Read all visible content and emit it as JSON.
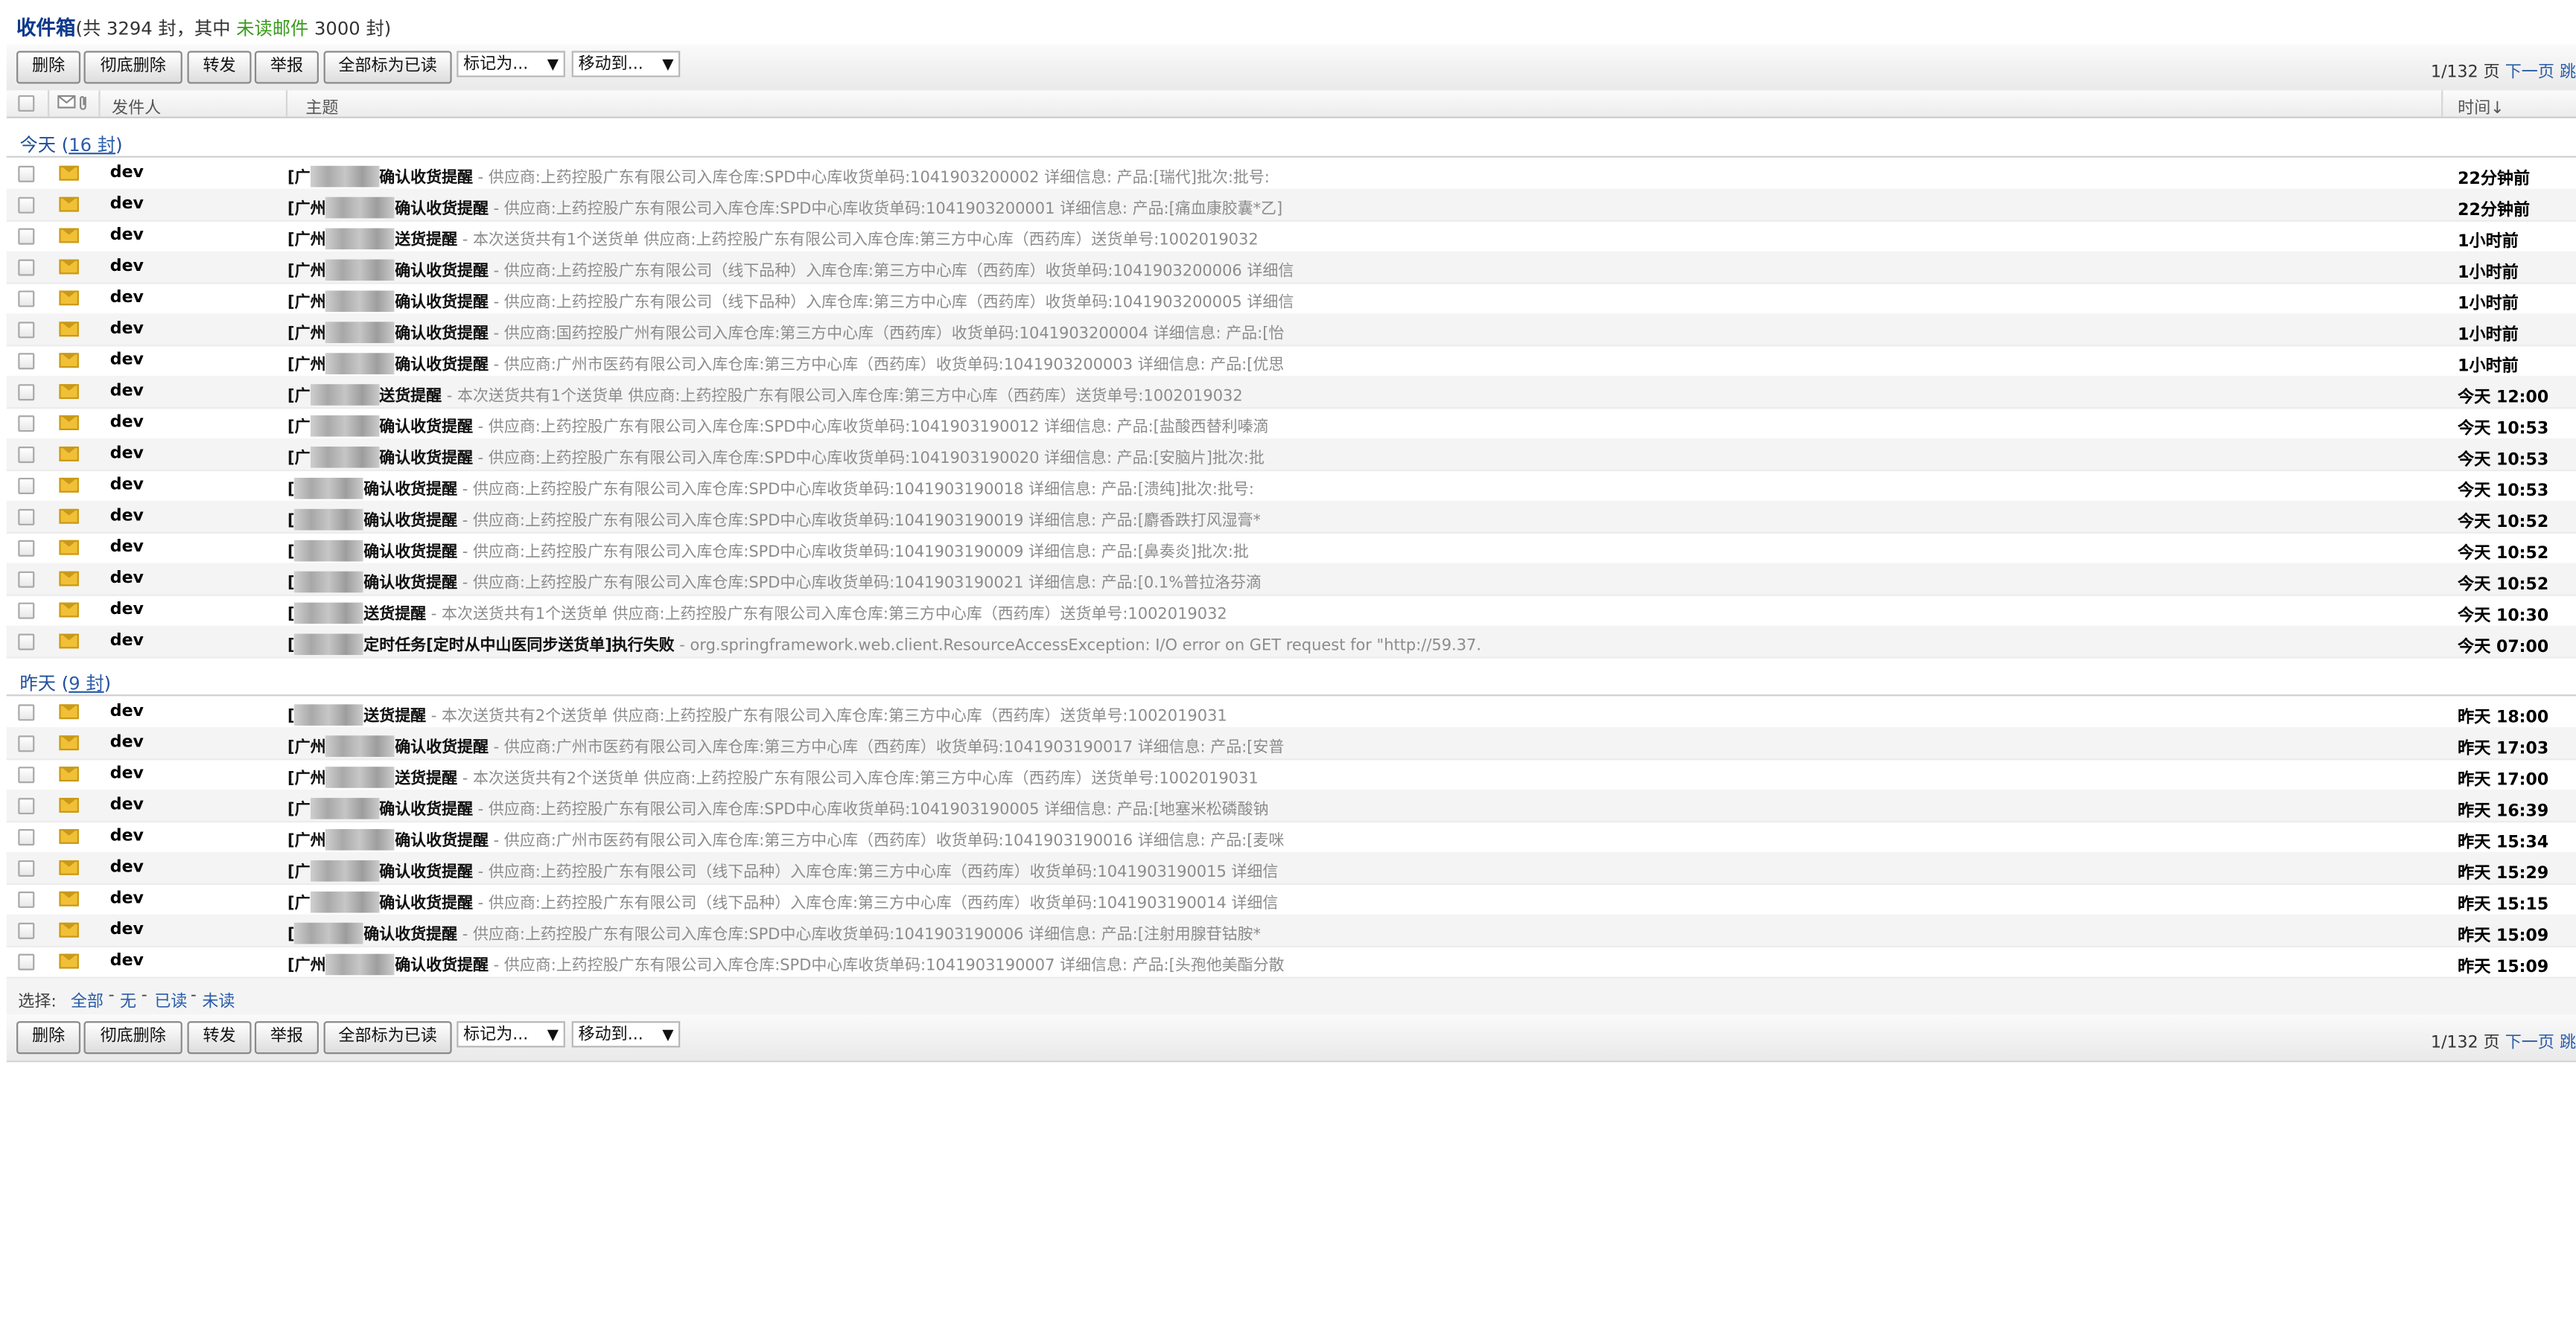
{
  "header": {
    "title": "收件箱",
    "summary_prefix": "(共 3294 封，其中 ",
    "unread_label": "未读邮件",
    "summary_suffix": " 3000 封)"
  },
  "toolbar": {
    "delete": "删除",
    "delete_perm": "彻底删除",
    "forward": "转发",
    "report": "举报",
    "mark_all_read": "全部标为已读",
    "mark_as": "标记为...",
    "move_to": "移动到...",
    "page": "1/132 页",
    "next": "下一页",
    "jump": "跳"
  },
  "columns": {
    "sender": "发件人",
    "subject": "主题",
    "time": "时间↓"
  },
  "groups": [
    {
      "label": "今天",
      "count": "16 封"
    },
    {
      "label": "昨天",
      "count": "9 封"
    }
  ],
  "emails_today": [
    {
      "sender": "dev",
      "prefix": "[广",
      "subject": "确认收货提醒",
      "preview": " - 供应商:上药控股广东有限公司入库仓库:SPD中心库收货单码:1041903200002 详细信息: 产品:[瑞代]批次:批号:",
      "time": "22分钟前"
    },
    {
      "sender": "dev",
      "prefix": "[广州",
      "subject": "确认收货提醒",
      "preview": " - 供应商:上药控股广东有限公司入库仓库:SPD中心库收货单码:1041903200001 详细信息: 产品:[痛血康胶囊*乙]",
      "time": "22分钟前"
    },
    {
      "sender": "dev",
      "prefix": "[广州",
      "subject": "送货提醒",
      "preview": " - 本次送货共有1个送货单 供应商:上药控股广东有限公司入库仓库:第三方中心库（西药库）送货单号:1002019032",
      "time": "1小时前"
    },
    {
      "sender": "dev",
      "prefix": "[广州",
      "subject": "确认收货提醒",
      "preview": " - 供应商:上药控股广东有限公司（线下品种）入库仓库:第三方中心库（西药库）收货单码:1041903200006 详细信",
      "time": "1小时前"
    },
    {
      "sender": "dev",
      "prefix": "[广州",
      "subject": "确认收货提醒",
      "preview": " - 供应商:上药控股广东有限公司（线下品种）入库仓库:第三方中心库（西药库）收货单码:1041903200005 详细信",
      "time": "1小时前"
    },
    {
      "sender": "dev",
      "prefix": "[广州",
      "subject": "确认收货提醒",
      "preview": " - 供应商:国药控股广州有限公司入库仓库:第三方中心库（西药库）收货单码:1041903200004 详细信息: 产品:[怡",
      "time": "1小时前"
    },
    {
      "sender": "dev",
      "prefix": "[广州",
      "subject": "确认收货提醒",
      "preview": " - 供应商:广州市医药有限公司入库仓库:第三方中心库（西药库）收货单码:1041903200003 详细信息: 产品:[优思",
      "time": "1小时前"
    },
    {
      "sender": "dev",
      "prefix": "[广",
      "subject": "送货提醒",
      "preview": " - 本次送货共有1个送货单 供应商:上药控股广东有限公司入库仓库:第三方中心库（西药库）送货单号:1002019032",
      "time": "今天 12:00"
    },
    {
      "sender": "dev",
      "prefix": "[广",
      "subject": "确认收货提醒",
      "preview": " - 供应商:上药控股广东有限公司入库仓库:SPD中心库收货单码:1041903190012 详细信息: 产品:[盐酸西替利嗪滴",
      "time": "今天 10:53"
    },
    {
      "sender": "dev",
      "prefix": "[广",
      "subject": "确认收货提醒",
      "preview": " - 供应商:上药控股广东有限公司入库仓库:SPD中心库收货单码:1041903190020 详细信息: 产品:[安脑片]批次:批",
      "time": "今天 10:53"
    },
    {
      "sender": "dev",
      "prefix": "[",
      "subject": "确认收货提醒",
      "preview": " - 供应商:上药控股广东有限公司入库仓库:SPD中心库收货单码:1041903190018 详细信息: 产品:[溃纯]批次:批号:",
      "time": "今天 10:53"
    },
    {
      "sender": "dev",
      "prefix": "[",
      "subject": "确认收货提醒",
      "preview": " - 供应商:上药控股广东有限公司入库仓库:SPD中心库收货单码:1041903190019 详细信息: 产品:[麝香跌打风湿膏*",
      "time": "今天 10:52"
    },
    {
      "sender": "dev",
      "prefix": "[",
      "subject": "确认收货提醒",
      "preview": " - 供应商:上药控股广东有限公司入库仓库:SPD中心库收货单码:1041903190009 详细信息: 产品:[鼻奏炎]批次:批",
      "time": "今天 10:52"
    },
    {
      "sender": "dev",
      "prefix": "[",
      "subject": "确认收货提醒",
      "preview": " - 供应商:上药控股广东有限公司入库仓库:SPD中心库收货单码:1041903190021 详细信息: 产品:[0.1%普拉洛芬滴",
      "time": "今天 10:52"
    },
    {
      "sender": "dev",
      "prefix": "[",
      "subject": "送货提醒",
      "preview": " - 本次送货共有1个送货单 供应商:上药控股广东有限公司入库仓库:第三方中心库（西药库）送货单号:1002019032",
      "time": "今天 10:30"
    },
    {
      "sender": "dev",
      "prefix": "[",
      "subject": "定时任务[定时从中山医同步送货单]执行失败",
      "preview": " - org.springframework.web.client.ResourceAccessException: I/O error on GET request for \"http://59.37.",
      "time": "今天 07:00"
    }
  ],
  "emails_yesterday": [
    {
      "sender": "dev",
      "prefix": "[",
      "subject": "送货提醒",
      "preview": " - 本次送货共有2个送货单 供应商:上药控股广东有限公司入库仓库:第三方中心库（西药库）送货单号:1002019031",
      "time": "昨天 18:00"
    },
    {
      "sender": "dev",
      "prefix": "[广州",
      "subject": "确认收货提醒",
      "preview": " - 供应商:广州市医药有限公司入库仓库:第三方中心库（西药库）收货单码:1041903190017 详细信息: 产品:[安普",
      "time": "昨天 17:03"
    },
    {
      "sender": "dev",
      "prefix": "[广州",
      "subject": "送货提醒",
      "preview": " - 本次送货共有2个送货单 供应商:上药控股广东有限公司入库仓库:第三方中心库（西药库）送货单号:1002019031",
      "time": "昨天 17:00"
    },
    {
      "sender": "dev",
      "prefix": "[广",
      "subject": "确认收货提醒",
      "preview": " - 供应商:上药控股广东有限公司入库仓库:SPD中心库收货单码:1041903190005 详细信息: 产品:[地塞米松磷酸钠",
      "time": "昨天 16:39"
    },
    {
      "sender": "dev",
      "prefix": "[广州",
      "subject": "确认收货提醒",
      "preview": " - 供应商:广州市医药有限公司入库仓库:第三方中心库（西药库）收货单码:1041903190016 详细信息: 产品:[麦咪",
      "time": "昨天 15:34"
    },
    {
      "sender": "dev",
      "prefix": "[广",
      "subject": "确认收货提醒",
      "preview": " - 供应商:上药控股广东有限公司（线下品种）入库仓库:第三方中心库（西药库）收货单码:1041903190015 详细信",
      "time": "昨天 15:29"
    },
    {
      "sender": "dev",
      "prefix": "[广",
      "subject": "确认收货提醒",
      "preview": " - 供应商:上药控股广东有限公司（线下品种）入库仓库:第三方中心库（西药库）收货单码:1041903190014 详细信",
      "time": "昨天 15:15"
    },
    {
      "sender": "dev",
      "prefix": "[",
      "subject": "确认收货提醒",
      "preview": " - 供应商:上药控股广东有限公司入库仓库:SPD中心库收货单码:1041903190006 详细信息: 产品:[注射用腺苷钴胺*",
      "time": "昨天 15:09"
    },
    {
      "sender": "dev",
      "prefix": "[广州",
      "subject": "确认收货提醒",
      "preview": " - 供应商:上药控股广东有限公司入库仓库:SPD中心库收货单码:1041903190007 详细信息: 产品:[头孢他美酯分散",
      "time": "昨天 15:09"
    }
  ],
  "select_bar": {
    "label": "选择:",
    "all": "全部",
    "none": "无",
    "read": "已读",
    "unread": "未读",
    "sep": "-"
  },
  "colors": {
    "link": "#2a5ca8",
    "title": "#0d3a8c",
    "unread": "#3a9a1c",
    "envelope": "#f2c037"
  }
}
